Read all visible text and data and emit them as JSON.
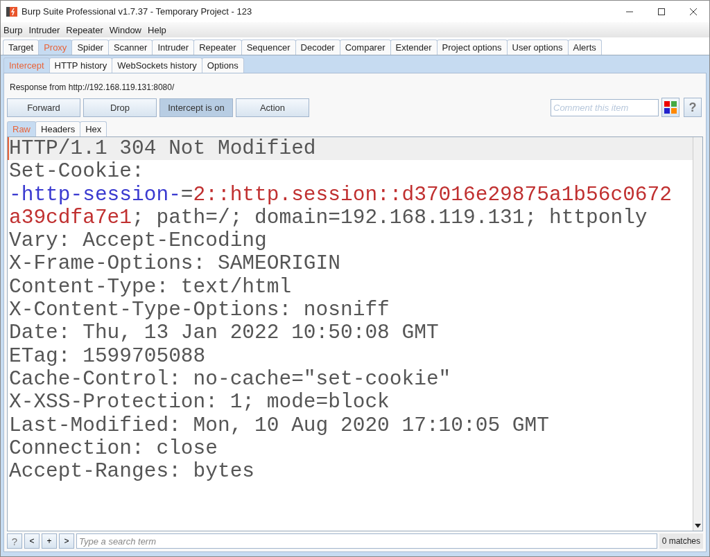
{
  "window": {
    "title": "Burp Suite Professional v1.7.37 - Temporary Project - 123"
  },
  "menu": [
    "Burp",
    "Intruder",
    "Repeater",
    "Window",
    "Help"
  ],
  "tabs": [
    {
      "label": "Target",
      "selected": false
    },
    {
      "label": "Proxy",
      "selected": true
    },
    {
      "label": "Spider",
      "selected": false
    },
    {
      "label": "Scanner",
      "selected": false
    },
    {
      "label": "Intruder",
      "selected": false
    },
    {
      "label": "Repeater",
      "selected": false
    },
    {
      "label": "Sequencer",
      "selected": false
    },
    {
      "label": "Decoder",
      "selected": false
    },
    {
      "label": "Comparer",
      "selected": false
    },
    {
      "label": "Extender",
      "selected": false
    },
    {
      "label": "Project options",
      "selected": false
    },
    {
      "label": "User options",
      "selected": false
    },
    {
      "label": "Alerts",
      "selected": false
    }
  ],
  "subtabs": [
    {
      "label": "Intercept",
      "selected": true
    },
    {
      "label": "HTTP history",
      "selected": false
    },
    {
      "label": "WebSockets history",
      "selected": false
    },
    {
      "label": "Options",
      "selected": false
    }
  ],
  "response_label": "Response from http://192.168.119.131:8080/",
  "buttons": [
    {
      "label": "Forward",
      "on": false
    },
    {
      "label": "Drop",
      "on": false
    },
    {
      "label": "Intercept is on",
      "on": true
    },
    {
      "label": "Action",
      "on": false
    }
  ],
  "comment": {
    "placeholder": "Comment this item"
  },
  "help_button": "?",
  "view_tabs": [
    {
      "label": "Raw",
      "selected": true
    },
    {
      "label": "Headers",
      "selected": false
    },
    {
      "label": "Hex",
      "selected": false
    }
  ],
  "lines": [
    [
      {
        "kind": "plain",
        "text": "HTTP/1.1 304 Not Modified"
      }
    ],
    [
      {
        "kind": "plain",
        "text": "Set-Cookie:"
      }
    ],
    [
      {
        "kind": "name",
        "text": "-http-session-"
      },
      {
        "kind": "plain",
        "text": "="
      },
      {
        "kind": "value",
        "text": "2::http.session::d37016e29875a1b56c0672"
      }
    ],
    [
      {
        "kind": "value",
        "text": "a39cdfa7e1"
      },
      {
        "kind": "plain",
        "text": "; path=/; domain=192.168.119.131; httponly"
      }
    ],
    [
      {
        "kind": "plain",
        "text": "Vary: Accept-Encoding"
      }
    ],
    [
      {
        "kind": "plain",
        "text": "X-Frame-Options: SAMEORIGIN"
      }
    ],
    [
      {
        "kind": "plain",
        "text": "Content-Type: text/html"
      }
    ],
    [
      {
        "kind": "plain",
        "text": "X-Content-Type-Options: nosniff"
      }
    ],
    [
      {
        "kind": "plain",
        "text": "Date: Thu, 13 Jan 2022 10:50:08 GMT"
      }
    ],
    [
      {
        "kind": "plain",
        "text": "ETag: 1599705088"
      }
    ],
    [
      {
        "kind": "plain",
        "text": "Cache-Control: no-cache=\"set-cookie\""
      }
    ],
    [
      {
        "kind": "plain",
        "text": "X-XSS-Protection: 1; mode=block"
      }
    ],
    [
      {
        "kind": "plain",
        "text": "Last-Modified: Mon, 10 Aug 2020 17:10:05 GMT"
      }
    ],
    [
      {
        "kind": "plain",
        "text": "Connection: close"
      }
    ],
    [
      {
        "kind": "plain",
        "text": "Accept-Ranges: bytes"
      }
    ]
  ],
  "search": {
    "buttons": [
      "?",
      "<",
      "+",
      ">"
    ],
    "placeholder": "Type a search term",
    "matches": "0 matches"
  }
}
